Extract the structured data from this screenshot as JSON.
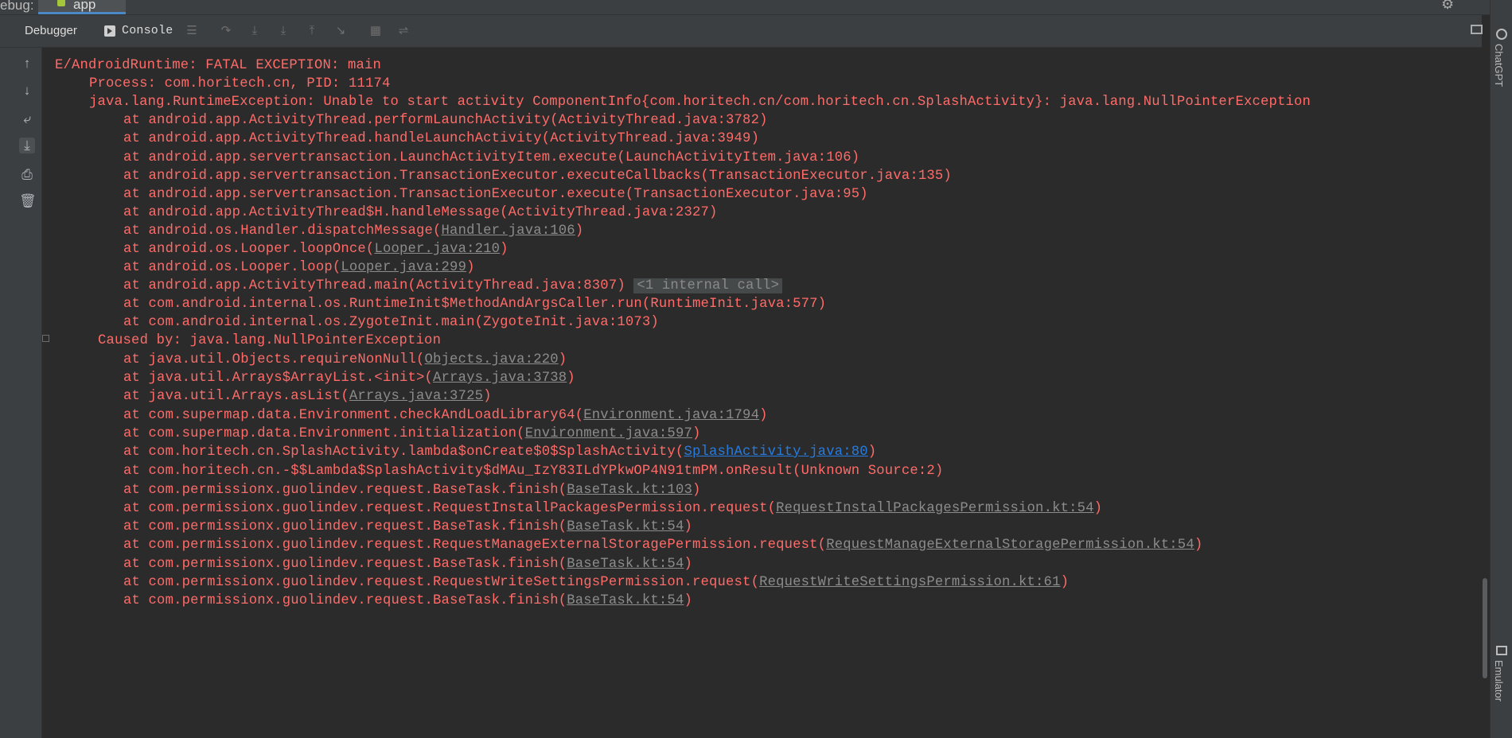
{
  "top_bar": {
    "label": "ebug:",
    "tab_label": "app",
    "settings_icon": "gear-icon",
    "minimize_icon": "minimize-icon"
  },
  "toolbar": {
    "tabs": [
      {
        "label": "Debugger"
      },
      {
        "label": "Console"
      }
    ],
    "icons": [
      "menu-icon",
      "step-over-icon",
      "step-into-icon",
      "force-step-into-icon",
      "step-out-icon",
      "run-to-cursor-icon",
      "evaluate-icon",
      "trace-icon"
    ]
  },
  "console_actions": [
    "up-arrow-icon",
    "down-arrow-icon",
    "soft-wrap-icon",
    "scroll-to-end-icon",
    "print-icon",
    "trash-icon"
  ],
  "log": {
    "l0": {
      "text": "E/AndroidRuntime: FATAL EXCEPTION: main"
    },
    "l1": {
      "text": "Process: com.horitech.cn, PID: 11174"
    },
    "l2": {
      "text": "java.lang.RuntimeException: Unable to start activity ComponentInfo{com.horitech.cn/com.horitech.cn.SplashActivity}: java.lang.NullPointerException"
    },
    "l3": {
      "text": "at android.app.ActivityThread.performLaunchActivity(ActivityThread.java:3782)"
    },
    "l4": {
      "text": "at android.app.ActivityThread.handleLaunchActivity(ActivityThread.java:3949)"
    },
    "l5": {
      "text": "at android.app.servertransaction.LaunchActivityItem.execute(LaunchActivityItem.java:106)"
    },
    "l6": {
      "text": "at android.app.servertransaction.TransactionExecutor.executeCallbacks(TransactionExecutor.java:135)"
    },
    "l7": {
      "text": "at android.app.servertransaction.TransactionExecutor.execute(TransactionExecutor.java:95)"
    },
    "l8": {
      "text": "at android.app.ActivityThread$H.handleMessage(ActivityThread.java:2327)"
    },
    "l9": {
      "pre": "at android.os.Handler.dispatchMessage(",
      "link": "Handler.java:106",
      "post": ")"
    },
    "l10": {
      "pre": "at android.os.Looper.loopOnce(",
      "link": "Looper.java:210",
      "post": ")"
    },
    "l11": {
      "pre": "at android.os.Looper.loop(",
      "link": "Looper.java:299",
      "post": ")"
    },
    "l12": {
      "pre": "at android.app.ActivityThread.main(ActivityThread.java:8307)",
      "fold": "<1 internal call>"
    },
    "l13": {
      "text": "at com.android.internal.os.RuntimeInit$MethodAndArgsCaller.run(RuntimeInit.java:577)"
    },
    "l14": {
      "text": "at com.android.internal.os.ZygoteInit.main(ZygoteInit.java:1073)"
    },
    "l15": {
      "text": "Caused by: java.lang.NullPointerException"
    },
    "l16": {
      "pre": "at java.util.Objects.requireNonNull(",
      "link": "Objects.java:220",
      "post": ")"
    },
    "l17": {
      "pre": "at java.util.Arrays$ArrayList.<init>(",
      "link": "Arrays.java:3738",
      "post": ")"
    },
    "l18": {
      "pre": "at java.util.Arrays.asList(",
      "link": "Arrays.java:3725",
      "post": ")"
    },
    "l19": {
      "pre": "at com.supermap.data.Environment.checkAndLoadLibrary64(",
      "link": "Environment.java:1794",
      "post": ")"
    },
    "l20": {
      "pre": "at com.supermap.data.Environment.initialization(",
      "link": "Environment.java:597",
      "post": ")"
    },
    "l21": {
      "pre": "at com.horitech.cn.SplashActivity.lambda$onCreate$0$SplashActivity(",
      "link": "SplashActivity.java:80",
      "post": ")"
    },
    "l22": {
      "text": "at com.horitech.cn.-$$Lambda$SplashActivity$dMAu_IzY83ILdYPkwOP4N91tmPM.onResult(Unknown Source:2)"
    },
    "l23": {
      "pre": "at com.permissionx.guolindev.request.BaseTask.finish(",
      "link": "BaseTask.kt:103",
      "post": ")"
    },
    "l24": {
      "pre": "at com.permissionx.guolindev.request.RequestInstallPackagesPermission.request(",
      "link": "RequestInstallPackagesPermission.kt:54",
      "post": ")"
    },
    "l25": {
      "pre": "at com.permissionx.guolindev.request.BaseTask.finish(",
      "link": "BaseTask.kt:54",
      "post": ")"
    },
    "l26": {
      "pre": "at com.permissionx.guolindev.request.RequestManageExternalStoragePermission.request(",
      "link": "RequestManageExternalStoragePermission.kt:54",
      "post": ")"
    },
    "l27": {
      "pre": "at com.permissionx.guolindev.request.BaseTask.finish(",
      "link": "BaseTask.kt:54",
      "post": ")"
    },
    "l28": {
      "pre": "at com.permissionx.guolindev.request.RequestWriteSettingsPermission.request(",
      "link": "RequestWriteSettingsPermission.kt:61",
      "post": ")"
    },
    "l29": {
      "pre": "at com.permissionx.guolindev.request.BaseTask.finish(",
      "link": "BaseTask.kt:54",
      "post": ")"
    }
  },
  "right_strip": {
    "chatgpt_label": "ChatGPT",
    "emulator_label": "Emulator"
  },
  "colors": {
    "error_text": "#ff6b68",
    "link": "#8c8c8c",
    "link_active": "#287bde",
    "background": "#2b2b2b",
    "toolbar": "#3c3f41"
  }
}
